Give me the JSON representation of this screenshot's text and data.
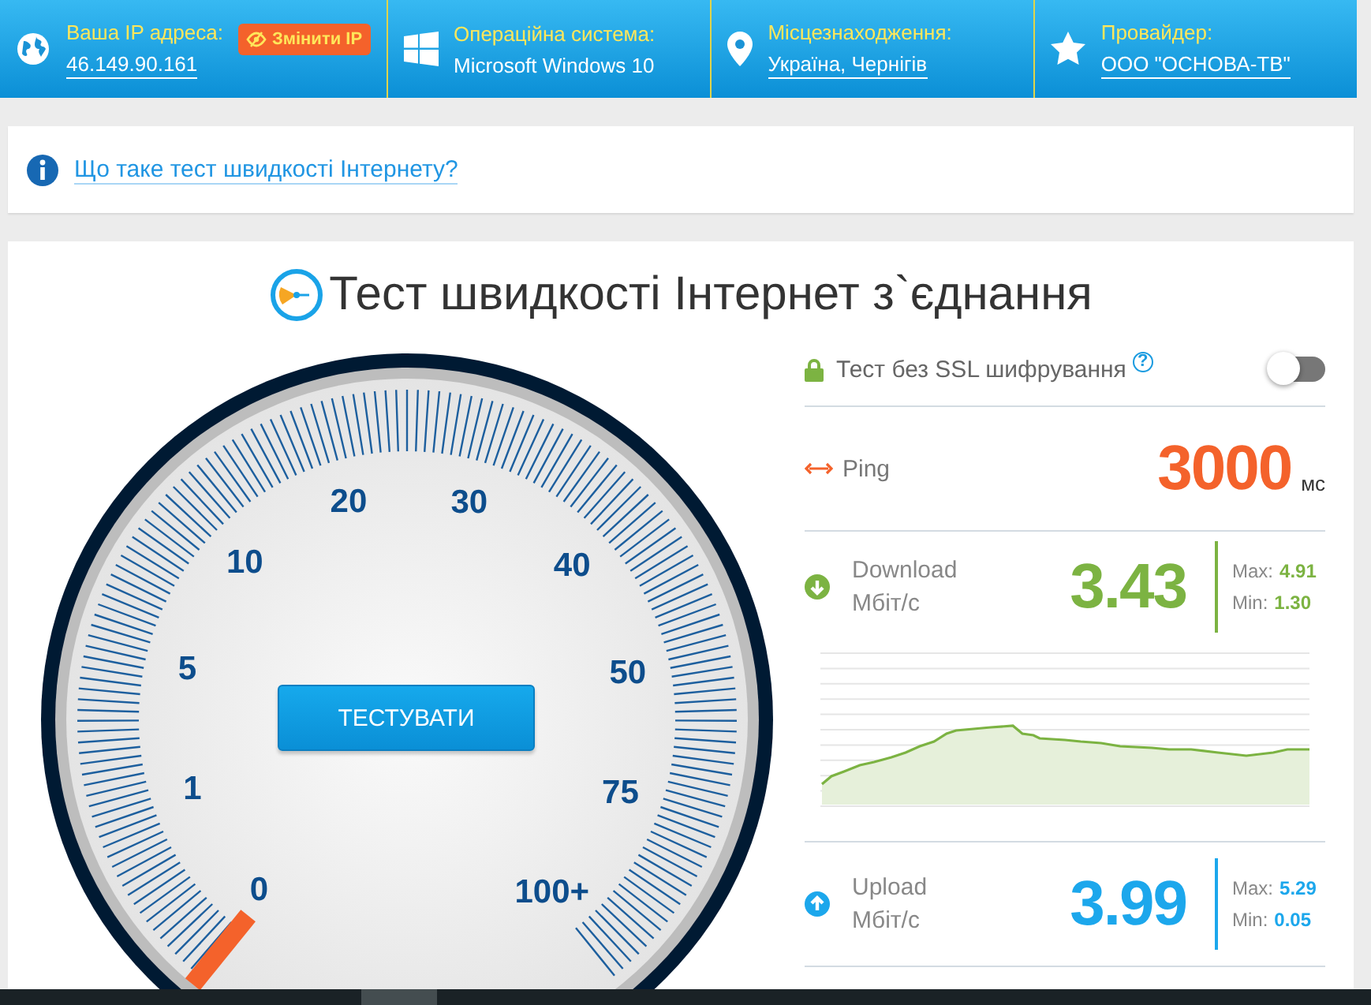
{
  "top_bar": {
    "cells": [
      {
        "kind": "ip",
        "label": "Ваша IP адреса:",
        "value": "46.149.90.161"
      },
      {
        "kind": "os",
        "label": "Операційна система:",
        "value": "Microsoft Windows 10"
      },
      {
        "kind": "location",
        "label": "Місцезнаходження:",
        "value": "Україна, Чернігів"
      },
      {
        "kind": "provider",
        "label": "Провайдер:",
        "value": "ООО \"ОСНОВА-ТВ\""
      }
    ],
    "change_ip_button": "Змінити IP"
  },
  "info_link": "Що таке тест швидкості Інтернету?",
  "title": "Тест швидкості Інтернет з`єднання",
  "gauge": {
    "labels": [
      "0",
      "1",
      "5",
      "10",
      "20",
      "30",
      "40",
      "50",
      "75",
      "100+"
    ],
    "button": "ТЕСТУВАТИ"
  },
  "ssl": {
    "label": "Тест без SSL шифрування",
    "help": "?",
    "on": false
  },
  "ping": {
    "label": "Ping",
    "value": "3000",
    "unit": "мс"
  },
  "download": {
    "label": "Download",
    "unit": "Мбіт/с",
    "value": "3.43",
    "max_label": "Max:",
    "max": "4.91",
    "min_label": "Min:",
    "min": "1.30"
  },
  "upload": {
    "label": "Upload",
    "unit": "Мбіт/с",
    "value": "3.99",
    "max_label": "Max:",
    "max": "5.29",
    "min_label": "Min:",
    "min": "0.05"
  }
}
